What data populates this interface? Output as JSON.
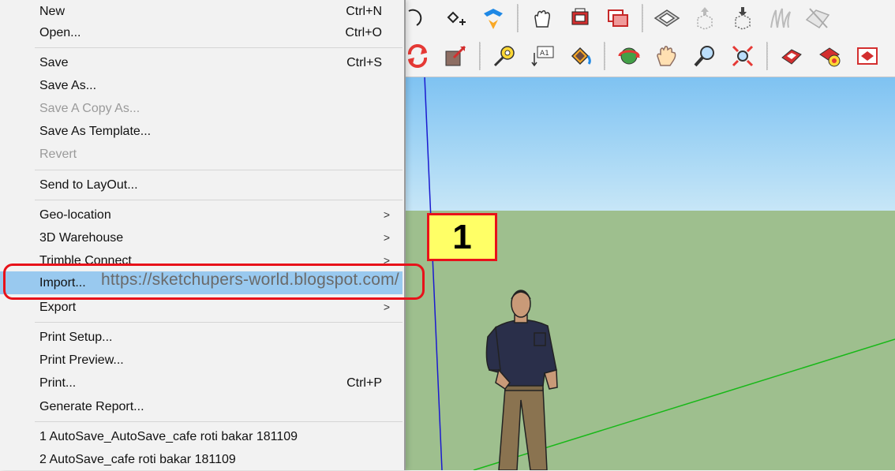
{
  "file_menu": {
    "items": [
      {
        "label": "New",
        "shortcut": "Ctrl+N"
      },
      {
        "label": "Open...",
        "shortcut": "Ctrl+O"
      },
      {
        "label": "Save",
        "shortcut": "Ctrl+S"
      },
      {
        "label": "Save As..."
      },
      {
        "label": "Save A Copy As...",
        "disabled": true
      },
      {
        "label": "Save As Template..."
      },
      {
        "label": "Revert",
        "disabled": true
      },
      {
        "label": "Send to LayOut..."
      },
      {
        "label": "Geo-location",
        "submenu": true
      },
      {
        "label": "3D Warehouse",
        "submenu": true
      },
      {
        "label": "Trimble Connect",
        "submenu": true
      },
      {
        "label": "Import...",
        "highlighted": true
      },
      {
        "label": "Export",
        "submenu": true
      },
      {
        "label": "Print Setup..."
      },
      {
        "label": "Print Preview..."
      },
      {
        "label": "Print...",
        "shortcut": "Ctrl+P"
      },
      {
        "label": "Generate Report..."
      },
      {
        "label": "1 AutoSave_AutoSave_cafe roti bakar 181109"
      },
      {
        "label": "2 AutoSave_cafe roti bakar 181109"
      }
    ],
    "submenu_arrow": ">"
  },
  "overlay": {
    "watermark": "https://sketchupers-world.blogspot.com/",
    "step_number": "1"
  },
  "toolbar": {
    "row1_icons": [
      "orbit-partial-icon",
      "add-location-icon",
      "trimble-connect-icon",
      "hand-select-icon",
      "component-red-icon",
      "component-stack-icon",
      "section-plane-icon",
      "upload-box-icon",
      "download-box-icon",
      "grass-sandbox-icon",
      "sandbox-flip-icon"
    ],
    "row2_icons": [
      "rotate-icon",
      "scale-icon",
      "tape-measure-icon",
      "text-label-icon",
      "paint-bucket-icon",
      "orbit-icon",
      "pan-hand-icon",
      "zoom-icon",
      "zoom-extents-icon",
      "layout-send-icon",
      "extension-warehouse-icon",
      "ruby-console-icon"
    ]
  },
  "colors": {
    "menu_bg": "#f2f2f2",
    "highlight": "#99c9ef",
    "sky": "#8ccbf3",
    "ground": "#9ebf8e",
    "callout_red": "#e8121a",
    "badge_yellow": "#ffff66"
  }
}
